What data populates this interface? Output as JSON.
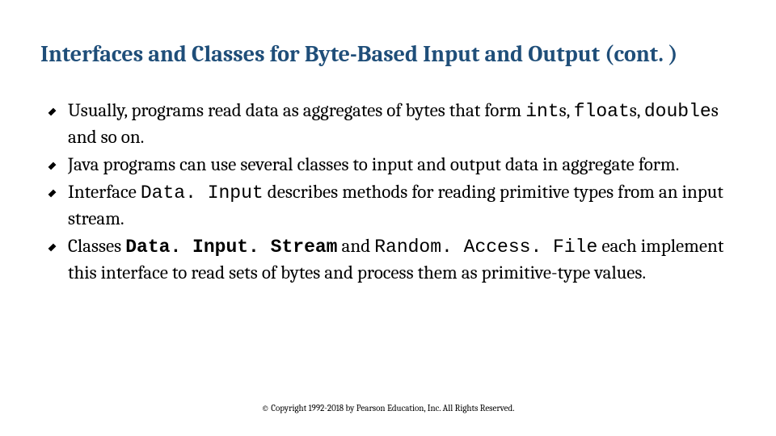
{
  "title": "Interfaces and Classes for Byte-Based Input and Output (cont. )",
  "bullets": [
    {
      "pre": "Usually, programs read data as aggregates of bytes that form ",
      "code1": "int",
      "mid1": "s, ",
      "code2": "float",
      "mid2": "s, ",
      "code3": "double",
      "post": "s and so on."
    },
    {
      "text": "Java programs can use several classes to input and output data in aggregate form."
    },
    {
      "pre": "Interface ",
      "code1": "Data. Input",
      "post": " describes methods for reading primitive types from an input stream."
    },
    {
      "pre": "Classes ",
      "code1": "Data. Input. Stream",
      "mid1": " and ",
      "code2": "Random. Access. File",
      "post": " each implement this interface to read sets of bytes and process them as primitive-type values."
    }
  ],
  "footer": "© Copyright 1992-2018 by Pearson Education, Inc. All Rights Reserved."
}
